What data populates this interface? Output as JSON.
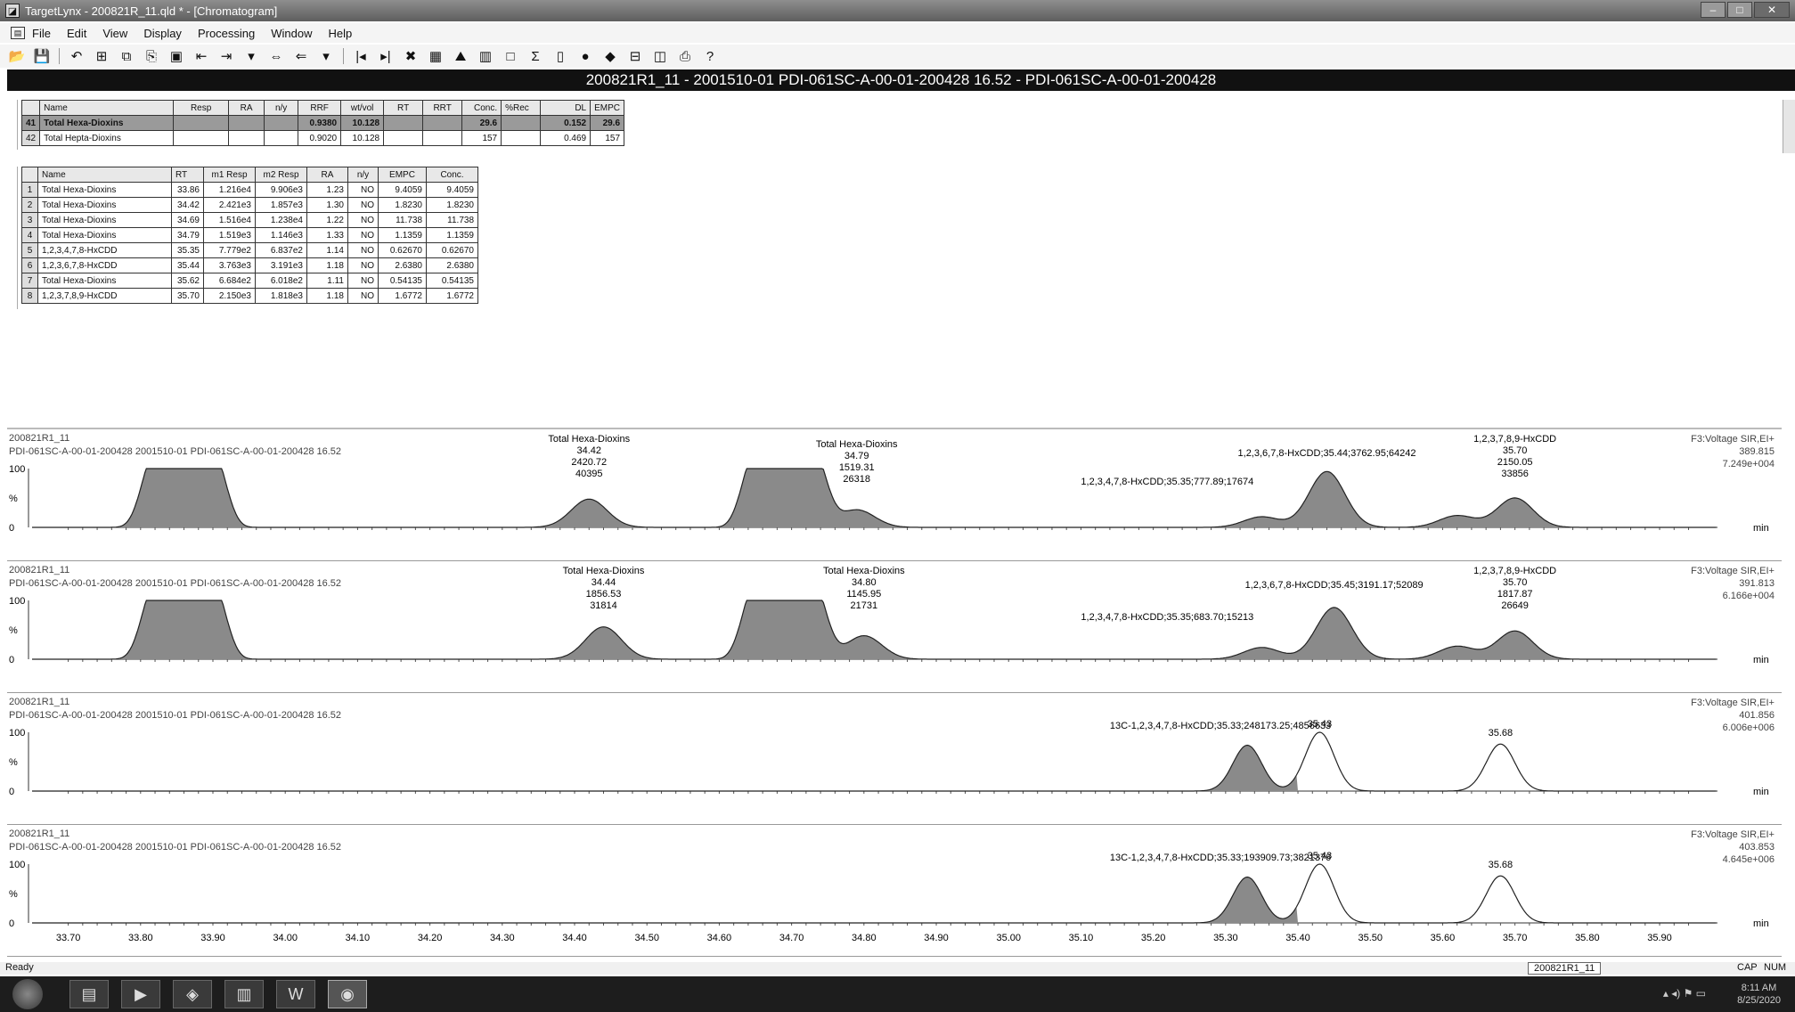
{
  "window": {
    "title": "TargetLynx - 200821R_11.qld * - [Chromatogram]"
  },
  "menu": [
    "File",
    "Edit",
    "View",
    "Display",
    "Processing",
    "Window",
    "Help"
  ],
  "header": "200821R1_11 - 2001510-01 PDI-061SC-A-00-01-200428 16.52 - PDI-061SC-A-00-01-200428",
  "summary_table": {
    "columns": [
      "",
      "Name",
      "Resp",
      "RA",
      "n/y",
      "RRF",
      "wt/vol",
      "RT",
      "RRT",
      "Conc.",
      "%Rec",
      "DL",
      "EMPC"
    ],
    "rows": [
      [
        "41",
        "Total Hexa-Dioxins",
        "",
        "",
        "",
        "0.9380",
        "10.128",
        "",
        "",
        "29.6",
        "",
        "0.152",
        "29.6"
      ],
      [
        "42",
        "Total Hepta-Dioxins",
        "",
        "",
        "",
        "0.9020",
        "10.128",
        "",
        "",
        "157",
        "",
        "0.469",
        "157"
      ]
    ]
  },
  "peak_table": {
    "columns": [
      "",
      "Name",
      "RT",
      "m1 Resp",
      "m2 Resp",
      "RA",
      "n/y",
      "EMPC",
      "Conc."
    ],
    "rows": [
      [
        "1",
        "Total Hexa-Dioxins",
        "33.86",
        "1.216e4",
        "9.906e3",
        "1.23",
        "NO",
        "9.4059",
        "9.4059"
      ],
      [
        "2",
        "Total Hexa-Dioxins",
        "34.42",
        "2.421e3",
        "1.857e3",
        "1.30",
        "NO",
        "1.8230",
        "1.8230"
      ],
      [
        "3",
        "Total Hexa-Dioxins",
        "34.69",
        "1.516e4",
        "1.238e4",
        "1.22",
        "NO",
        "11.738",
        "11.738"
      ],
      [
        "4",
        "Total Hexa-Dioxins",
        "34.79",
        "1.519e3",
        "1.146e3",
        "1.33",
        "NO",
        "1.1359",
        "1.1359"
      ],
      [
        "5",
        "1,2,3,4,7,8-HxCDD",
        "35.35",
        "7.779e2",
        "6.837e2",
        "1.14",
        "NO",
        "0.62670",
        "0.62670"
      ],
      [
        "6",
        "1,2,3,6,7,8-HxCDD",
        "35.44",
        "3.763e3",
        "3.191e3",
        "1.18",
        "NO",
        "2.6380",
        "2.6380"
      ],
      [
        "7",
        "Total Hexa-Dioxins",
        "35.62",
        "6.684e2",
        "6.018e2",
        "1.11",
        "NO",
        "0.54135",
        "0.54135"
      ],
      [
        "8",
        "1,2,3,7,8,9-HxCDD",
        "35.70",
        "2.150e3",
        "1.818e3",
        "1.18",
        "NO",
        "1.6772",
        "1.6772"
      ]
    ]
  },
  "panels": [
    {
      "sample": "200821R1_11",
      "desc": "PDI-061SC-A-00-01-200428 2001510-01 PDI-061SC-A-00-01-200428 16.52",
      "fn": [
        "F3:Voltage SIR,EI+",
        "389.815",
        "7.249e+004"
      ],
      "annotations": [
        [
          "Total Hexa-Dioxins",
          "34.42",
          "2420.72",
          "40395"
        ],
        [
          "Total Hexa-Dioxins",
          "34.79",
          "1519.31",
          "26318"
        ],
        [
          "1,2,3,6,7,8-HxCDD;35.44;3762.95;64242"
        ],
        [
          "1,2,3,7,8,9-HxCDD",
          "35.70",
          "2150.05",
          "33856"
        ],
        [
          "1,2,3,4,7,8-HxCDD;35.35;777.89;17674"
        ]
      ]
    },
    {
      "sample": "200821R1_11",
      "desc": "PDI-061SC-A-00-01-200428 2001510-01 PDI-061SC-A-00-01-200428 16.52",
      "fn": [
        "F3:Voltage SIR,EI+",
        "391.813",
        "6.166e+004"
      ],
      "annotations": [
        [
          "Total Hexa-Dioxins",
          "34.44",
          "1856.53",
          "31814"
        ],
        [
          "Total Hexa-Dioxins",
          "34.80",
          "1145.95",
          "21731"
        ],
        [
          "1,2,3,6,7,8-HxCDD;35.45;3191.17;52089"
        ],
        [
          "1,2,3,7,8,9-HxCDD",
          "35.70",
          "1817.87",
          "26649"
        ],
        [
          "1,2,3,4,7,8-HxCDD;35.35;683.70;15213"
        ]
      ]
    },
    {
      "sample": "200821R1_11",
      "desc": "PDI-061SC-A-00-01-200428 2001510-01 PDI-061SC-A-00-01-200428 16.52",
      "fn": [
        "F3:Voltage SIR,EI+",
        "401.856",
        "6.006e+006"
      ],
      "annotations": [
        [
          "13C-1,2,3,4,7,8-HxCDD;35.33;248173.25;4856633"
        ],
        [
          "35.43"
        ],
        [
          "35.68"
        ]
      ]
    },
    {
      "sample": "200821R1_11",
      "desc": "PDI-061SC-A-00-01-200428 2001510-01 PDI-061SC-A-00-01-200428 16.52",
      "fn": [
        "F3:Voltage SIR,EI+",
        "403.853",
        "4.645e+006"
      ],
      "annotations": [
        [
          "13C-1,2,3,4,7,8-HxCDD;35.33;193909.73;3821376"
        ],
        [
          "35.43"
        ],
        [
          "35.68"
        ]
      ]
    }
  ],
  "y_ticks": [
    "100",
    "%",
    "0"
  ],
  "x_unit": "min",
  "x_ticks": [
    "33.70",
    "33.80",
    "33.90",
    "34.00",
    "34.10",
    "34.20",
    "34.30",
    "34.40",
    "34.50",
    "34.60",
    "34.70",
    "34.80",
    "34.90",
    "35.00",
    "35.10",
    "35.20",
    "35.30",
    "35.40",
    "35.50",
    "35.60",
    "35.70",
    "35.80",
    "35.90"
  ],
  "status": {
    "ready": "Ready",
    "file": "200821R1_11",
    "caps": "CAP",
    "num": "NUM"
  },
  "clock": {
    "time": "8:11 AM",
    "date": "8/25/2020"
  },
  "chart_data": {
    "type": "line",
    "x_range": [
      33.65,
      35.98
    ],
    "series": [
      {
        "name": "F3:Voltage SIR,EI+ 389.815",
        "peaks": [
          [
            33.86,
            100
          ],
          [
            34.42,
            48
          ],
          [
            34.69,
            100
          ],
          [
            34.79,
            30
          ],
          [
            35.35,
            18
          ],
          [
            35.44,
            95
          ],
          [
            35.62,
            20
          ],
          [
            35.7,
            50
          ]
        ]
      },
      {
        "name": "F3:Voltage SIR,EI+ 391.813",
        "peaks": [
          [
            33.86,
            100
          ],
          [
            34.44,
            55
          ],
          [
            34.69,
            100
          ],
          [
            34.8,
            40
          ],
          [
            35.35,
            20
          ],
          [
            35.45,
            88
          ],
          [
            35.62,
            22
          ],
          [
            35.7,
            48
          ]
        ]
      },
      {
        "name": "F3:Voltage SIR,EI+ 401.856",
        "peaks": [
          [
            35.33,
            78
          ],
          [
            35.43,
            100
          ],
          [
            35.68,
            80
          ]
        ]
      },
      {
        "name": "F3:Voltage SIR,EI+ 403.853",
        "peaks": [
          [
            35.33,
            78
          ],
          [
            35.43,
            100
          ],
          [
            35.68,
            80
          ]
        ]
      }
    ]
  }
}
